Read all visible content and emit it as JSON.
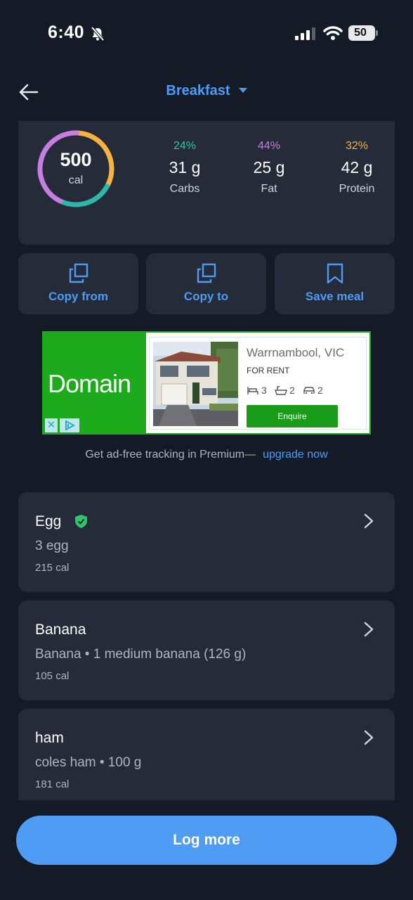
{
  "status": {
    "time": "6:40",
    "battery": "50",
    "icons": [
      "bell-slash-icon",
      "signal-icon",
      "wifi-icon",
      "battery-icon"
    ]
  },
  "header": {
    "title": "Breakfast",
    "back_icon": "arrow-left-icon",
    "caret_icon": "caret-down-icon"
  },
  "summary": {
    "calories": "500",
    "calories_unit": "cal",
    "ring_segments": [
      {
        "color": "#f5b340",
        "fraction": 0.32
      },
      {
        "color": "#2bb8a8",
        "fraction": 0.24
      },
      {
        "color": "#c67ee0",
        "fraction": 0.44
      }
    ],
    "macros": [
      {
        "pct": "24%",
        "grams": "31 g",
        "label": "Carbs",
        "color": "#2ec4b0"
      },
      {
        "pct": "44%",
        "grams": "25 g",
        "label": "Fat",
        "color": "#c67ee0"
      },
      {
        "pct": "32%",
        "grams": "42 g",
        "label": "Protein",
        "color": "#f5b340"
      }
    ]
  },
  "actions": [
    {
      "label": "Copy from",
      "icon": "copy-icon"
    },
    {
      "label": "Copy to",
      "icon": "copy-icon"
    },
    {
      "label": "Save meal",
      "icon": "bookmark-icon"
    }
  ],
  "ad": {
    "brand": "Domain",
    "location": "Warrnambool, VIC",
    "type": "FOR RENT",
    "beds": "3",
    "baths": "2",
    "cars": "2",
    "button": "Enquire",
    "close_mark": "✕"
  },
  "premium": {
    "text": "Get ad-free tracking in Premium—",
    "link": "upgrade now"
  },
  "foods": [
    {
      "name": "Egg",
      "description": "3 egg",
      "calories": "215 cal",
      "verified": true
    },
    {
      "name": "Banana",
      "description": "Banana • 1 medium banana  (126 g)",
      "calories": "105 cal",
      "verified": false
    },
    {
      "name": "ham",
      "description": "coles ham • 100 g",
      "calories": "181 cal",
      "verified": false
    }
  ],
  "log_button": "Log more",
  "colors": {
    "accent": "#4f9cf5",
    "background": "#151b26",
    "card": "#252b38",
    "ad_green": "#1dab1d"
  }
}
